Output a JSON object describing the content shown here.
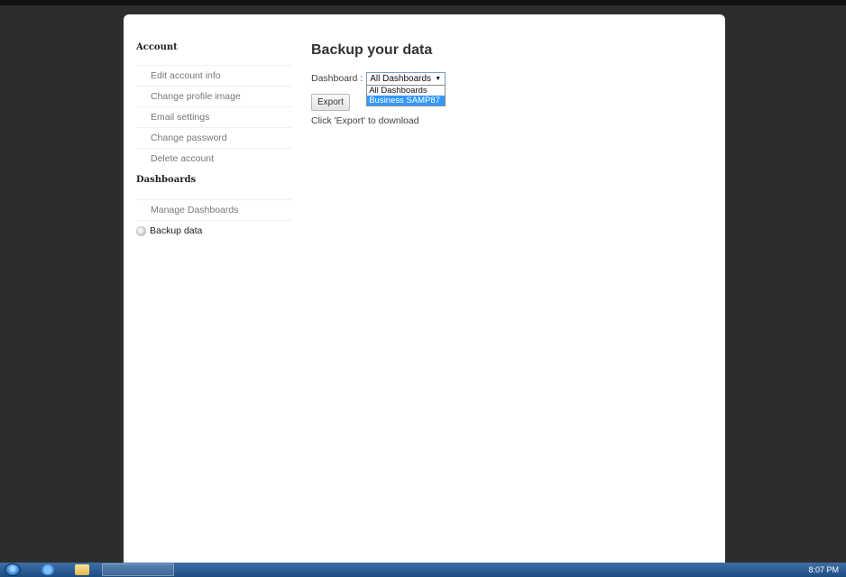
{
  "sidebar": {
    "account_title": "Account",
    "account_items": [
      {
        "label": "Edit account info"
      },
      {
        "label": "Change profile image"
      },
      {
        "label": "Email settings"
      },
      {
        "label": "Change password"
      },
      {
        "label": "Delete account"
      }
    ],
    "dashboards_title": "Dashboards",
    "dashboards_items": [
      {
        "label": "Manage Dashboards"
      }
    ],
    "active_item": {
      "label": "Backup data",
      "icon": "radio-bullet-icon"
    }
  },
  "main": {
    "title": "Backup your data",
    "dashboard_label": "Dashboard :",
    "select": {
      "selected_value": "All Dashboards",
      "options": [
        "All Dashboards",
        "Business SAMP87"
      ],
      "highlighted_option": "Business SAMP87"
    },
    "export_label": "Export",
    "hint": "Click 'Export' to download"
  },
  "taskbar": {
    "clock": "8:07 PM",
    "icons": [
      "start-orb-icon",
      "internet-explorer-icon",
      "folder-icon"
    ]
  },
  "colors": {
    "background": "#2d2d2d",
    "highlight": "#3399ff",
    "taskbar": "#1d4b82"
  }
}
